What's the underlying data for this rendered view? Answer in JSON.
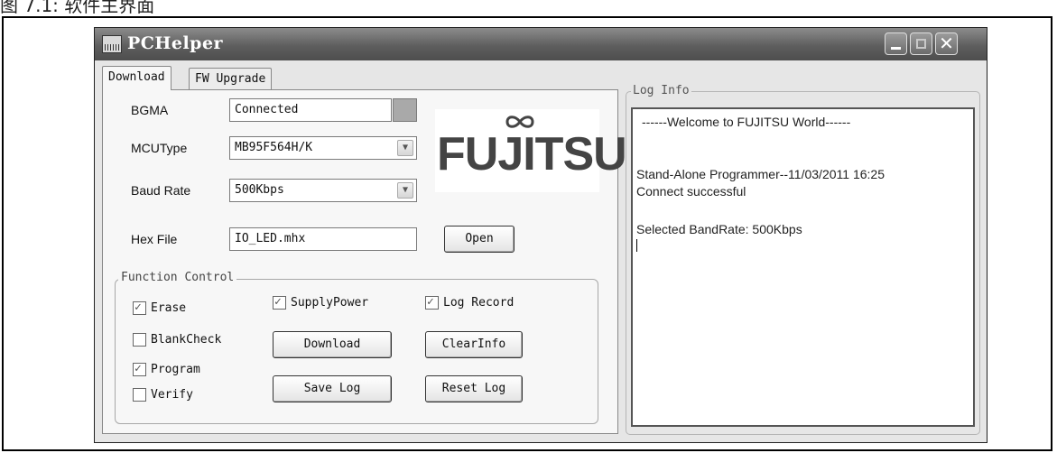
{
  "caption": "图 7.1: 软件主界面",
  "window": {
    "title": "PCHelper"
  },
  "tabs": [
    {
      "label": "Download"
    },
    {
      "label": "FW Upgrade"
    }
  ],
  "form": {
    "bgma": {
      "label": "BGMA",
      "value": "Connected"
    },
    "mcu_type": {
      "label": "MCUType",
      "value": "MB95F564H/K"
    },
    "baud_rate": {
      "label": "Baud Rate",
      "value": "500Kbps"
    },
    "hex_file": {
      "label": "Hex File",
      "value": "IO_LED.mhx",
      "open_label": "Open"
    }
  },
  "logo": {
    "text": "FUJITSU"
  },
  "function_control": {
    "legend": "Function Control",
    "checkboxes": [
      {
        "label": "Erase",
        "checked": true
      },
      {
        "label": "BlankCheck",
        "checked": false
      },
      {
        "label": "Program",
        "checked": true
      },
      {
        "label": "Verify",
        "checked": false
      },
      {
        "label": "SupplyPower",
        "checked": true
      },
      {
        "label": "Log Record",
        "checked": true
      }
    ],
    "buttons": {
      "download": "Download",
      "clear_info": "ClearInfo",
      "save_log": "Save Log",
      "reset_log": "Reset Log"
    }
  },
  "log": {
    "legend": "Log Info",
    "lines": [
      "------Welcome to FUJITSU World------",
      "Stand-Alone Programmer--11/03/2011 16:25",
      "Connect successful",
      "Selected BandRate: 500Kbps"
    ]
  },
  "icons": {
    "app": "app-icon",
    "minimize": "minimize-icon",
    "maximize": "maximize-icon",
    "close": "close-icon",
    "dropdown": "chevron-down-icon"
  },
  "colors": {
    "titlebar": "#5e5e5e",
    "window_bg": "#e6e6e6",
    "status_connected": "#a9a9a9"
  }
}
